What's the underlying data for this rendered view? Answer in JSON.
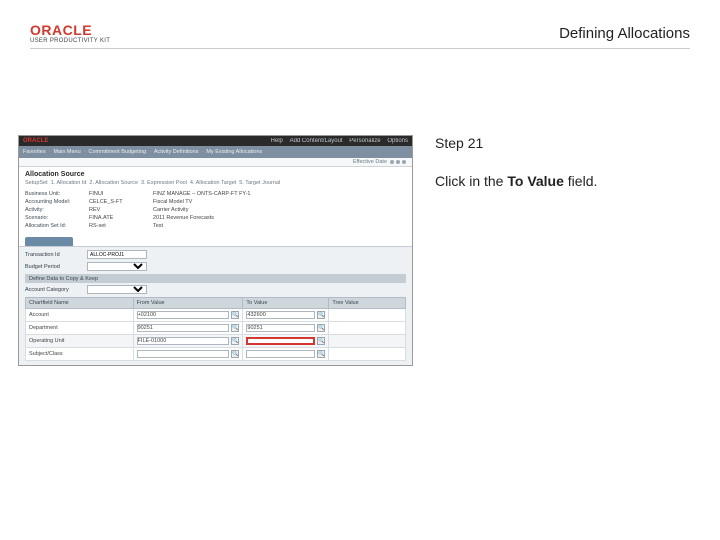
{
  "header": {
    "logo_brand": "ORACLE",
    "logo_sub": "USER PRODUCTIVITY KIT",
    "page_title": "Defining Allocations"
  },
  "instruction": {
    "step_label": "Step 21",
    "text_before": "Click in the ",
    "text_bold": "To Value",
    "text_after": " field."
  },
  "app": {
    "brand": "ORACLE",
    "top_links": [
      "Help",
      "Add Content/Layout",
      "Personalize",
      "Options"
    ],
    "nav": [
      "Favorites",
      "Main Menu",
      "Commitment Budgeting",
      "Activity Definitions",
      "My Existing Allocations"
    ],
    "status_label": "Effective Date",
    "section_title": "Allocation Source",
    "steps": [
      "SetupSet",
      "1. Allocation Id",
      "2. Allocation Source",
      "3. Expression Pool",
      "4. Allocation Target",
      "5. Target Journal"
    ],
    "kv": {
      "r1": {
        "lbl": "Business Unit:",
        "v1": "FINUI",
        "v2": "FINZ MANAGE – ONTS-CARP-FT FY-1"
      },
      "r2": {
        "lbl": "Accounting Model:",
        "v1": "CELCE_S-FT",
        "v2": "Fiscal Model TV"
      },
      "r3": {
        "lbl": "Activity:",
        "v1": "REV",
        "v2": "Carrier Activity"
      },
      "r4": {
        "lbl": "Scenario:",
        "v1": "FINA.ATE",
        "v2": "2011 Revenue Forecasts"
      },
      "r5": {
        "lbl": "Allocation Set Id:",
        "v1": "RS-set",
        "v2": "Test"
      }
    },
    "panel": {
      "row1_label": "Transaction Id",
      "row1_value": "ALLOC-PROJ1",
      "row2_label": "Budget Period",
      "row3_label": "Account Category",
      "strip_label": "Define Data to Copy & Keep"
    },
    "table": {
      "headers": [
        "Chartfield Name",
        "From Value",
        "To Value",
        "Tree Value"
      ],
      "rows": [
        {
          "name": "Account",
          "from": "+02100",
          "to": "432600"
        },
        {
          "name": "Department",
          "from": "90251",
          "to": "90251"
        },
        {
          "name": "Operating Unit",
          "from": "FILE-01000",
          "to": ""
        },
        {
          "name": "Subject/Class",
          "from": "",
          "to": ""
        }
      ]
    }
  }
}
